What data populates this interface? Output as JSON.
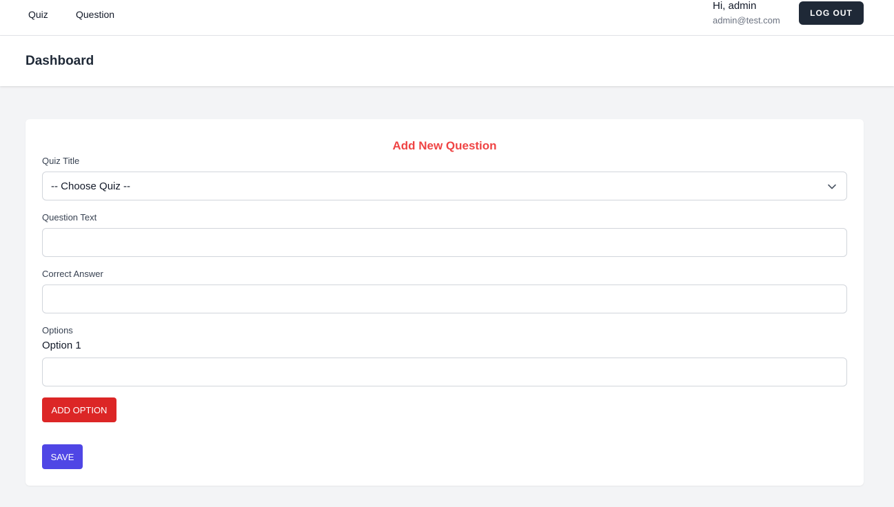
{
  "nav": {
    "links": [
      "Quiz",
      "Question"
    ]
  },
  "user": {
    "greeting": "Hi, admin",
    "email": "admin@test.com",
    "logout_label": "LOG OUT"
  },
  "header": {
    "title": "Dashboard"
  },
  "form": {
    "title": "Add New Question",
    "quiz_title_label": "Quiz Title",
    "quiz_select_value": "-- Choose Quiz --",
    "question_text_label": "Question Text",
    "question_text_value": "",
    "correct_answer_label": "Correct Answer",
    "correct_answer_value": "",
    "options_label": "Options",
    "option_1_label": "Option 1",
    "option_1_value": "",
    "add_option_label": "ADD OPTION",
    "save_label": "SAVE"
  },
  "colors": {
    "title_accent": "#ef4444",
    "add_option_button": "#dc2626",
    "save_button": "#4f46e5",
    "logout_button": "#1f2937",
    "page_background": "#f3f4f6"
  },
  "icons": {
    "select_arrow": "chevron-down-icon"
  }
}
